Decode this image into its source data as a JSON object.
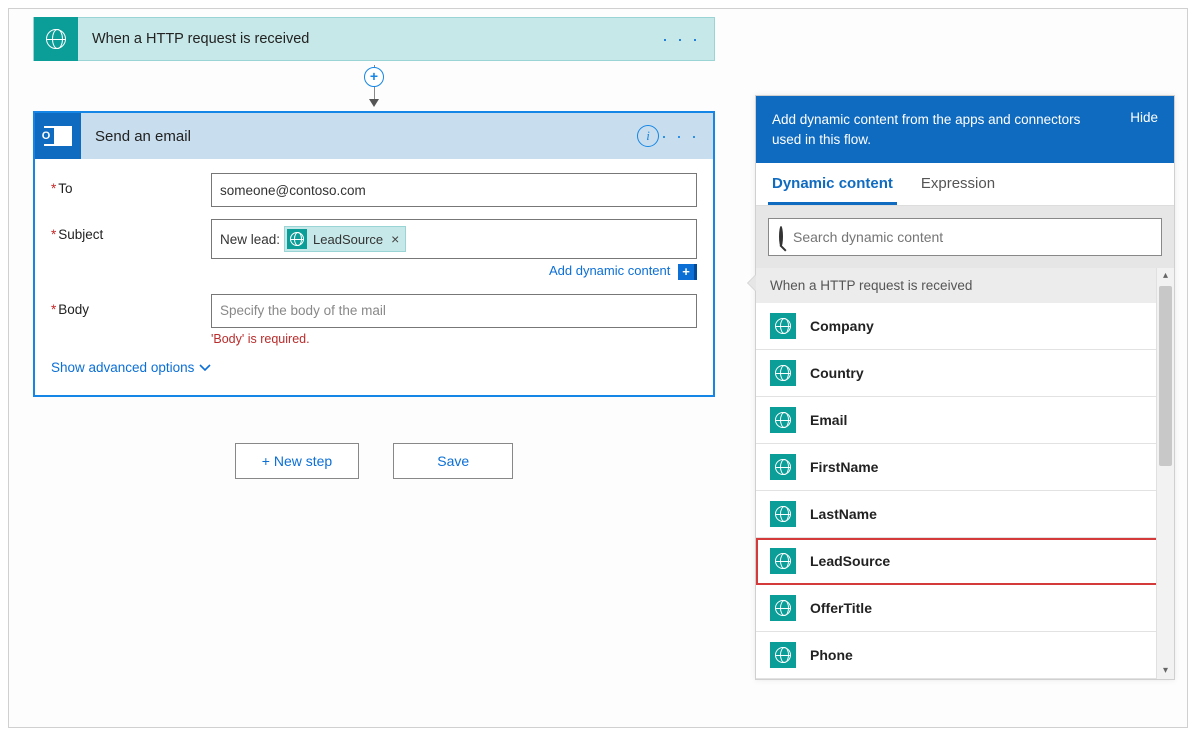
{
  "trigger": {
    "title": "When a HTTP request is received"
  },
  "action": {
    "title": "Send an email",
    "fields": {
      "to_label": "To",
      "to_value": "someone@contoso.com",
      "subject_label": "Subject",
      "subject_prefix": "New lead: ",
      "subject_token": "LeadSource",
      "body_label": "Body",
      "body_placeholder": "Specify the body of the mail",
      "body_error": "'Body' is required."
    },
    "add_dynamic_link": "Add dynamic content",
    "advanced_link": "Show advanced options"
  },
  "buttons": {
    "new_step": "+ New step",
    "save": "Save"
  },
  "dynamic_panel": {
    "header_text": "Add dynamic content from the apps and connectors used in this flow.",
    "hide": "Hide",
    "tabs": {
      "dynamic": "Dynamic content",
      "expression": "Expression"
    },
    "search_placeholder": "Search dynamic content",
    "group_title": "When a HTTP request is received",
    "items": [
      "Company",
      "Country",
      "Email",
      "FirstName",
      "LastName",
      "LeadSource",
      "OfferTitle",
      "Phone"
    ],
    "highlight_index": 5
  }
}
